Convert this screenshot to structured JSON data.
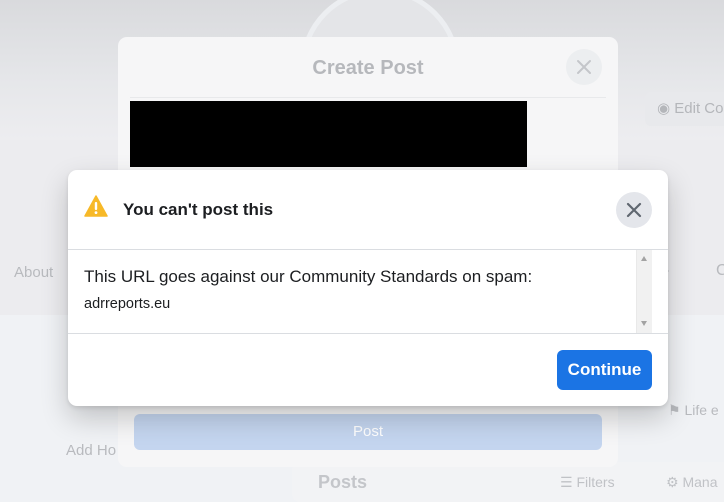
{
  "background": {
    "edit_button_label": "Edit Co",
    "about_tab": "About",
    "next_arrow": "›",
    "next_label": "C",
    "life_events": "Life e",
    "add_hobbies": "Add Ho",
    "posts_heading": "Posts",
    "filters_label": "Filters",
    "manage_label": "Mana"
  },
  "create_post": {
    "title": "Create Post",
    "post_button_label": "Post"
  },
  "alert": {
    "title": "You can't post this",
    "message": "This URL goes against our Community Standards on spam:",
    "url": "adrreports.eu",
    "continue_label": "Continue",
    "warning_color": "#f7b928",
    "accent_color": "#1b74e4"
  }
}
